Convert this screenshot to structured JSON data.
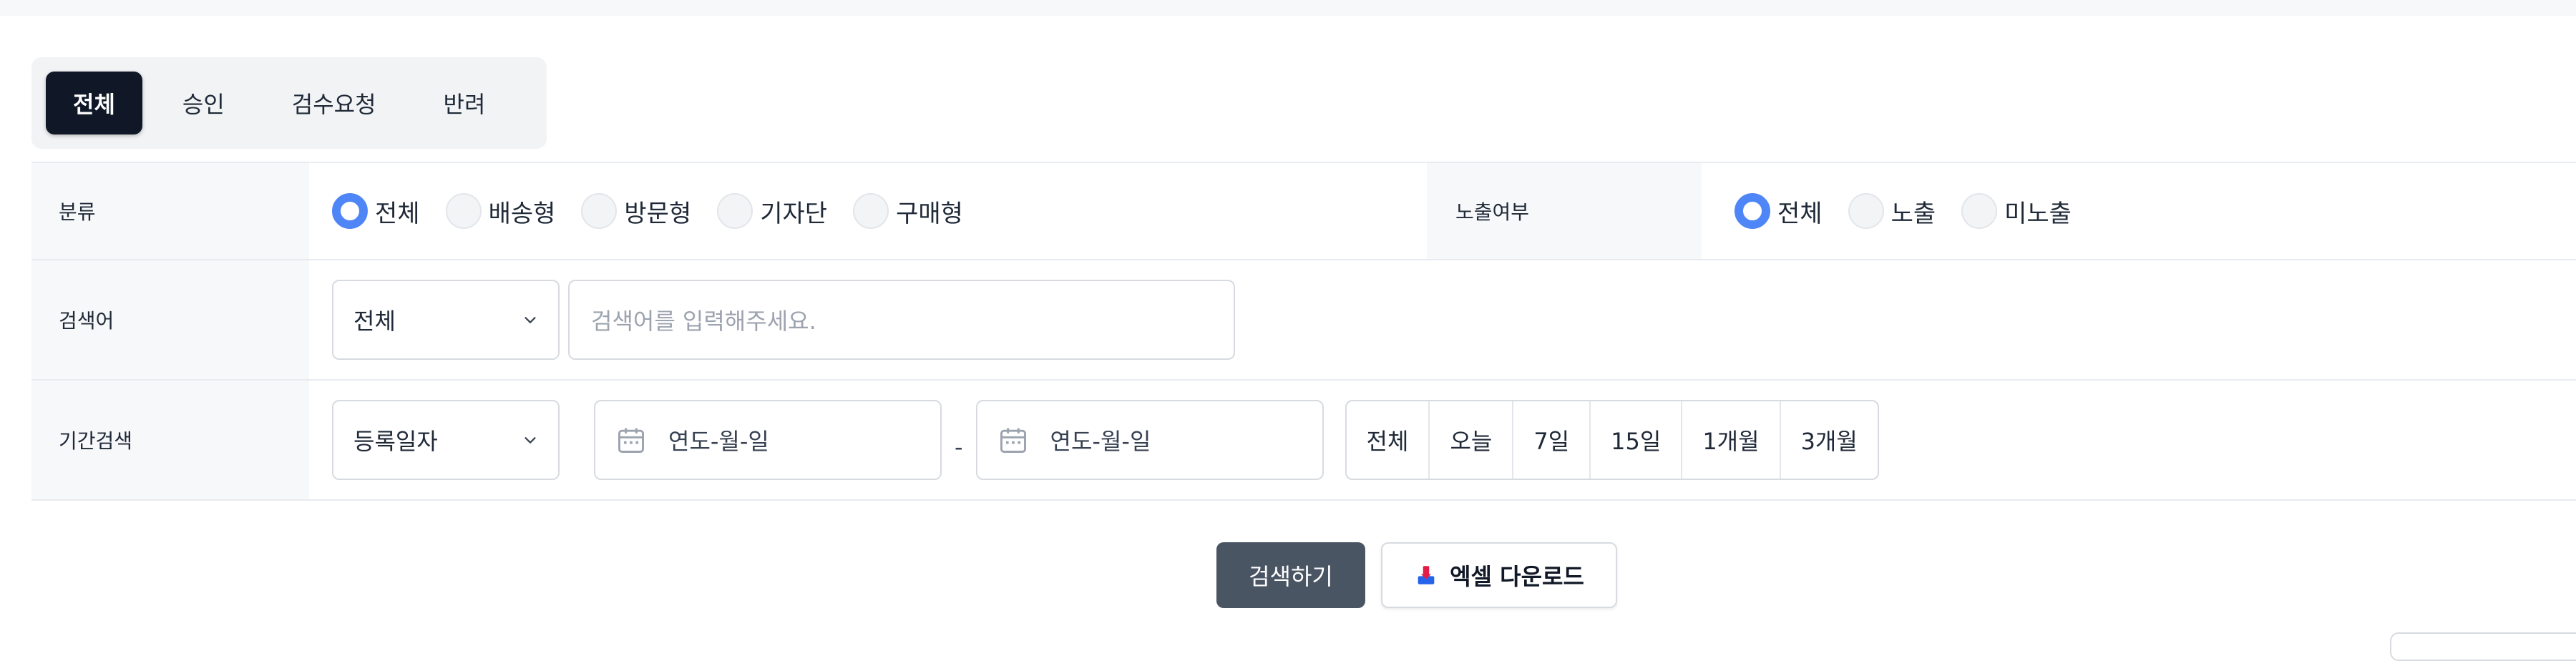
{
  "tabs": [
    {
      "label": "전체",
      "active": true
    },
    {
      "label": "승인",
      "active": false
    },
    {
      "label": "검수요청",
      "active": false
    },
    {
      "label": "반려",
      "active": false
    }
  ],
  "filters": {
    "category": {
      "label": "분류",
      "options": [
        "전체",
        "배송형",
        "방문형",
        "기자단",
        "구매형"
      ],
      "selected": "전체"
    },
    "exposure": {
      "label": "노출여부",
      "options": [
        "전체",
        "노출",
        "미노출"
      ],
      "selected": "전체"
    },
    "keyword": {
      "label": "검색어",
      "select_value": "전체",
      "placeholder": "검색어를 입력해주세요."
    },
    "period": {
      "label": "기간검색",
      "select_value": "등록일자",
      "start_placeholder": "연도-월-일",
      "end_placeholder": "연도-월-일",
      "separator": "-",
      "quick_ranges": [
        "전체",
        "오늘",
        "7일",
        "15일",
        "1개월",
        "3개월"
      ]
    }
  },
  "actions": {
    "search_label": "검색하기",
    "excel_label": "엑셀 다운로드"
  },
  "colors": {
    "active_tab": "#101828",
    "radio_accent": "#4f86f7",
    "search_button": "#4a5563"
  }
}
